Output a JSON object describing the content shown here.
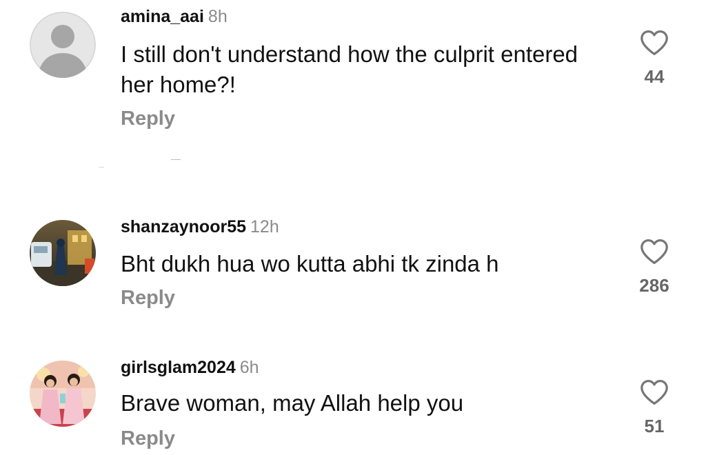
{
  "comments": [
    {
      "username": "amina_aai",
      "time": "8h",
      "text": "I still don't understand how the culprit entered her home?!",
      "reply_label": "Reply",
      "likes": "44",
      "avatar_icon": "default-avatar-icon"
    },
    {
      "username": "shanzaynoor55",
      "time": "12h",
      "text": "Bht dukh hua wo kutta abhi tk zinda h",
      "reply_label": "Reply",
      "likes": "286",
      "avatar_icon": "street-photo-avatar"
    },
    {
      "username": "girlsglam2024",
      "time": "6h",
      "text": "Brave woman, may Allah help you",
      "reply_label": "Reply",
      "likes": "51",
      "avatar_icon": "girls-photo-avatar"
    }
  ],
  "colors": {
    "text": "#111111",
    "muted": "#8a8a8a",
    "heart_stroke": "#777777"
  }
}
